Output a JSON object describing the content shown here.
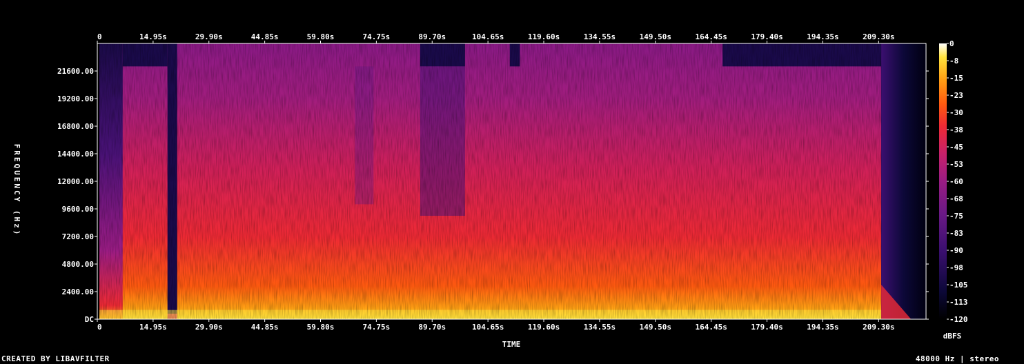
{
  "chart_data": {
    "type": "heatmap",
    "title": "",
    "xlabel": "TIME",
    "ylabel": "FREQUENCY (Hz)",
    "colorbar_label": "dBFS",
    "x_ticks": [
      "0",
      "14.95s",
      "29.90s",
      "44.85s",
      "59.80s",
      "74.75s",
      "89.70s",
      "104.65s",
      "119.60s",
      "134.55s",
      "149.50s",
      "164.45s",
      "179.40s",
      "194.35s",
      "209.30s"
    ],
    "x_tick_values": [
      0,
      14.95,
      29.9,
      44.85,
      59.8,
      74.75,
      89.7,
      104.65,
      119.6,
      134.55,
      149.5,
      164.45,
      179.4,
      194.35,
      209.3
    ],
    "xlim": [
      0,
      222
    ],
    "y_ticks": [
      "DC",
      "2400.00",
      "4800.00",
      "7200.00",
      "9600.00",
      "12000.00",
      "14400.00",
      "16800.00",
      "19200.00",
      "21600.00"
    ],
    "y_tick_values": [
      0,
      2400,
      4800,
      7200,
      9600,
      12000,
      14400,
      16800,
      19200,
      21600
    ],
    "ylim": [
      0,
      24000
    ],
    "colorbar_ticks": [
      "0",
      "-8",
      "-15",
      "-23",
      "-30",
      "-38",
      "-45",
      "-53",
      "-60",
      "-68",
      "-75",
      "-83",
      "-90",
      "-98",
      "-105",
      "-113",
      "-120"
    ],
    "colorbar_range": [
      -120,
      0
    ],
    "colormap": [
      "#000000",
      "#0c0838",
      "#3b0f70",
      "#6a1985",
      "#9a1c84",
      "#c8216a",
      "#ee2a35",
      "#ff5a10",
      "#ffa014",
      "#ffe23c",
      "#ffffff"
    ]
  },
  "footer": {
    "left": "CREATED BY LIBAVFILTER",
    "right": "48000 Hz | stereo"
  }
}
